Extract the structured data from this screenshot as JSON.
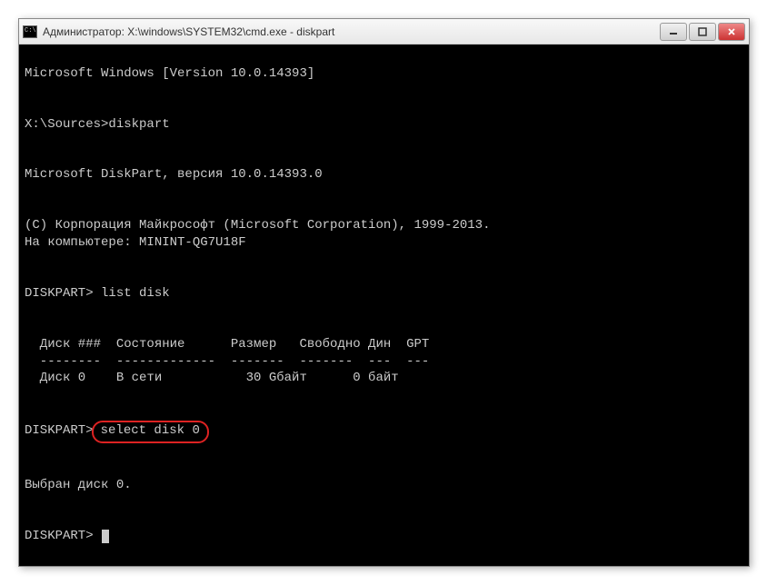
{
  "window": {
    "title": "Администратор: X:\\windows\\SYSTEM32\\cmd.exe - diskpart"
  },
  "terminal": {
    "lines": {
      "l1": "Microsoft Windows [Version 10.0.14393]",
      "l2": "X:\\Sources>diskpart",
      "l3": "Microsoft DiskPart, версия 10.0.14393.0",
      "l4": "(C) Корпорация Майкрософт (Microsoft Corporation), 1999-2013.",
      "l5": "На компьютере: MININT-QG7U18F",
      "l6_prompt": "DISKPART> ",
      "l6_cmd": "list disk",
      "l7": "  Диск ###  Состояние      Размер   Свободно Дин  GPT",
      "l8": "  --------  -------------  -------  -------  ---  ---",
      "l9": "  Диск 0    В сети           30 Gбайт      0 байт",
      "l10_prompt": "DISKPART>",
      "l10_cmd": "select disk 0",
      "l11": "Выбран диск 0.",
      "l12": "DISKPART> "
    }
  },
  "chart_data": {
    "type": "table",
    "title": "list disk",
    "columns": [
      "Диск ###",
      "Состояние",
      "Размер",
      "Свободно",
      "Дин",
      "GPT"
    ],
    "rows": [
      {
        "disk": "Диск 0",
        "status": "В сети",
        "size": "30 Gбайт",
        "free": "0 байт",
        "dyn": "",
        "gpt": ""
      }
    ]
  }
}
